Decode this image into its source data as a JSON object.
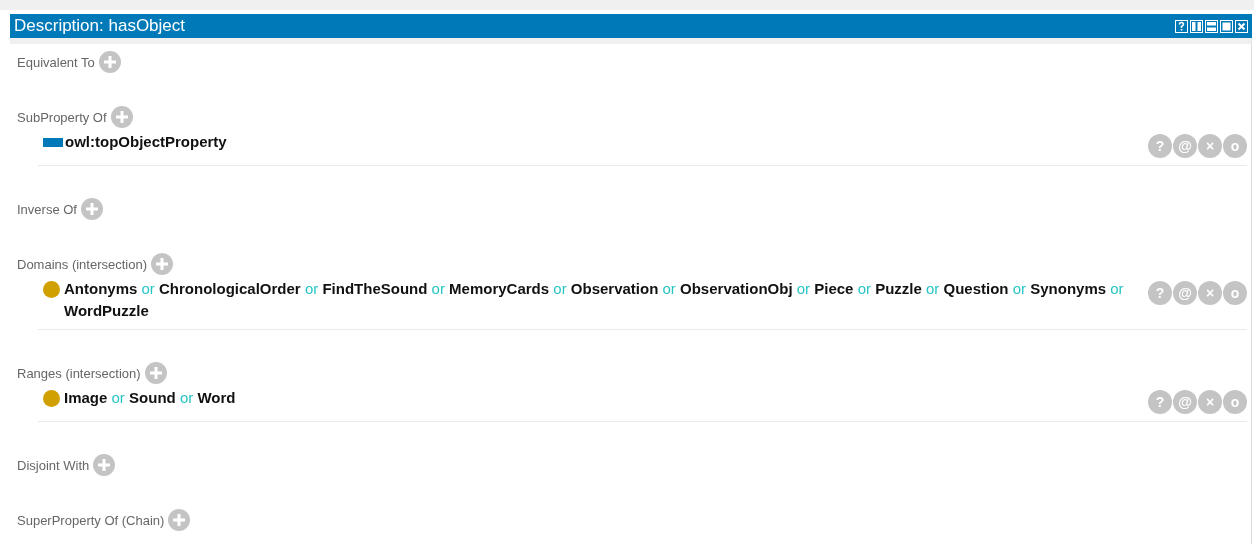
{
  "panel": {
    "title": "Description: hasObject",
    "sections": [
      {
        "label": "Equivalent To"
      },
      {
        "label": "SubProperty Of",
        "entries": [
          {
            "kind": "property",
            "parts": [
              {
                "kind": "name",
                "text": "owl:topObjectProperty"
              }
            ],
            "actions": [
              "?",
              "@",
              "×",
              "o"
            ]
          }
        ]
      },
      {
        "label": "Inverse Of"
      },
      {
        "label": "Domains (intersection)",
        "entries": [
          {
            "kind": "class",
            "parts": [
              {
                "kind": "name",
                "text": "Antonyms"
              },
              {
                "kind": "keyword",
                "text": "or"
              },
              {
                "kind": "name",
                "text": "ChronologicalOrder"
              },
              {
                "kind": "keyword",
                "text": "or"
              },
              {
                "kind": "name",
                "text": "FindTheSound"
              },
              {
                "kind": "keyword",
                "text": "or"
              },
              {
                "kind": "name",
                "text": "MemoryCards"
              },
              {
                "kind": "keyword",
                "text": "or"
              },
              {
                "kind": "name",
                "text": "Observation"
              },
              {
                "kind": "keyword",
                "text": "or"
              },
              {
                "kind": "name",
                "text": "ObservationObj"
              },
              {
                "kind": "keyword",
                "text": "or"
              },
              {
                "kind": "name",
                "text": "Piece"
              },
              {
                "kind": "keyword",
                "text": "or"
              },
              {
                "kind": "name",
                "text": "Puzzle"
              },
              {
                "kind": "keyword",
                "text": "or"
              },
              {
                "kind": "name",
                "text": "Question"
              },
              {
                "kind": "keyword",
                "text": "or"
              },
              {
                "kind": "name",
                "text": "Synonyms"
              },
              {
                "kind": "keyword",
                "text": "or"
              },
              {
                "kind": "name",
                "text": "WordPuzzle"
              }
            ],
            "actions": [
              "?",
              "@",
              "×",
              "o"
            ]
          }
        ]
      },
      {
        "label": "Ranges (intersection)",
        "entries": [
          {
            "kind": "class",
            "parts": [
              {
                "kind": "name",
                "text": "Image"
              },
              {
                "kind": "keyword",
                "text": "or"
              },
              {
                "kind": "name",
                "text": "Sound"
              },
              {
                "kind": "keyword",
                "text": "or"
              },
              {
                "kind": "name",
                "text": "Word"
              }
            ],
            "actions": [
              "?",
              "@",
              "×",
              "o"
            ]
          }
        ]
      },
      {
        "label": "Disjoint With"
      },
      {
        "label": "SuperProperty Of (Chain)"
      }
    ]
  }
}
